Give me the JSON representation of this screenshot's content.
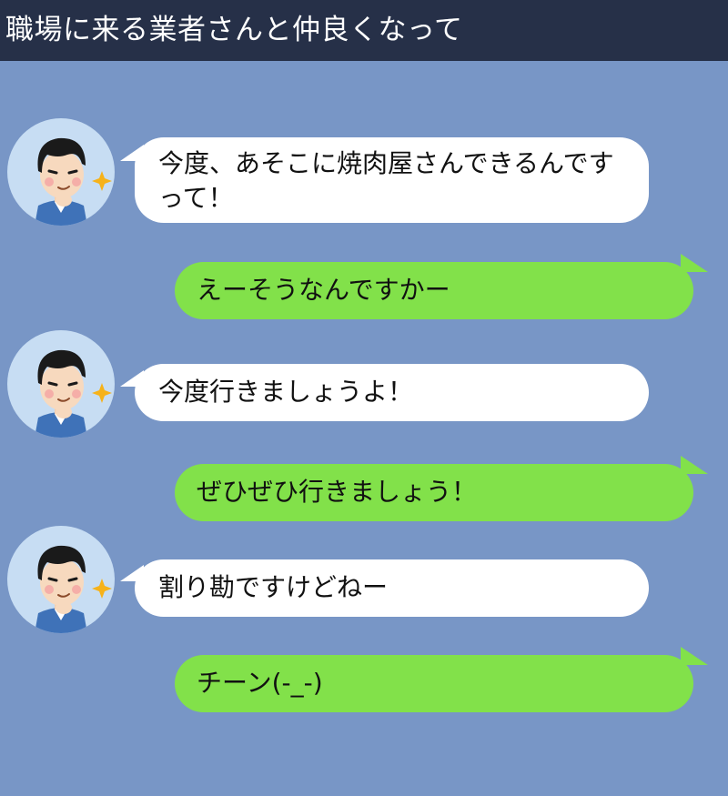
{
  "header": {
    "title": "職場に来る業者さんと仲良くなって"
  },
  "messages": [
    {
      "side": "in",
      "text": "今度、あそこに焼肉屋さんできるんですって！"
    },
    {
      "side": "out",
      "text": "えーそうなんですかー"
    },
    {
      "side": "in",
      "text": "今度行きましょうよ！"
    },
    {
      "side": "out",
      "text": "ぜひぜひ行きましょう！"
    },
    {
      "side": "in",
      "text": "割り勘ですけどねー"
    },
    {
      "side": "out",
      "text": "チーン(-_-)"
    }
  ],
  "colors": {
    "header_bg": "#263048",
    "chat_bg": "#7896c6",
    "incoming_bubble": "#ffffff",
    "outgoing_bubble": "#82e14a",
    "avatar_bg": "#c7ddf3"
  },
  "icons": {
    "avatar": "smug-man-avatar-icon",
    "sparkle": "sparkle-icon"
  }
}
